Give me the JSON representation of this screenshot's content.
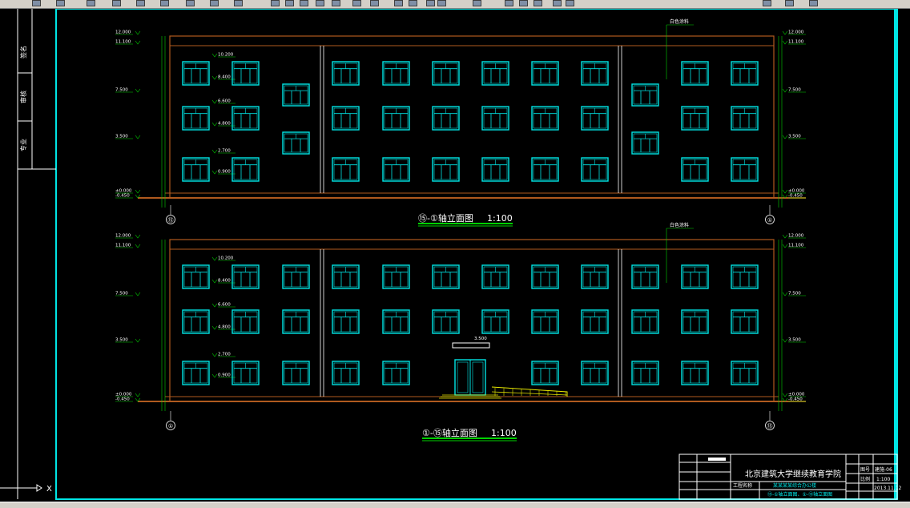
{
  "drawing": {
    "elevation_top_title": "⑮-①轴立面图",
    "elevation_bottom_title": "①-⑮轴立面图",
    "scale": "1:100",
    "material_note": "白色涂料",
    "left_axis_top": "⑮",
    "right_axis_top": "①",
    "left_axis_bottom": "①",
    "right_axis_bottom": "⑮",
    "levels": [
      "12.000",
      "11.100",
      "7.500",
      "3.500",
      "±0.000",
      "-0.450"
    ],
    "window_levels": [
      "10.200",
      "8.400",
      "6.600",
      "4.800",
      "2.700",
      "0.900"
    ],
    "canopy_level": "3.500"
  },
  "sidebar": {
    "labels": [
      "签名",
      "审核",
      "专业"
    ]
  },
  "title_block": {
    "institute": "北京建筑大学继续教育学院",
    "project_label": "工程名称",
    "project_name": "某某某某综合办公楼",
    "drawing_name": "⑮-①轴立面图、①-⑮轴立面图",
    "scale_label": "比例",
    "scale_value": "1:100",
    "date_value": "2013.11.12",
    "sheet_label": "图号",
    "sheet_value": "建施-06"
  },
  "ucs": {
    "x_label": "X"
  },
  "colors": {
    "window": "#00e5e5",
    "wall": "#b05a1e",
    "frame": "#00e5e5",
    "text": "#ffffff",
    "green": "#00d000",
    "stair": "#e6e600"
  }
}
